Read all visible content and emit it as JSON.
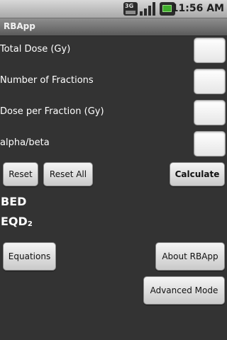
{
  "status_bar": {
    "network_label": "3G",
    "time": "11:56 AM",
    "icons": [
      "network-3g-icon",
      "signal-strength-icon",
      "battery-icon"
    ]
  },
  "app": {
    "title": "RBApp"
  },
  "inputs": [
    {
      "label": "Total Dose (Gy)",
      "value": ""
    },
    {
      "label": "Number of Fractions",
      "value": ""
    },
    {
      "label": "Dose per Fraction (Gy)",
      "value": ""
    },
    {
      "label": "alpha/beta",
      "value": ""
    }
  ],
  "buttons": {
    "reset": "Reset",
    "reset_all": "Reset All",
    "calculate": "Calculate",
    "equations": "Equations",
    "about": "About RBApp",
    "advanced": "Advanced Mode"
  },
  "results": {
    "bed_label": "BED",
    "eqd_label": "EQD",
    "eqd_subscript": "2"
  },
  "colors": {
    "background": "#333333",
    "battery_accent": "#3fae2c"
  }
}
